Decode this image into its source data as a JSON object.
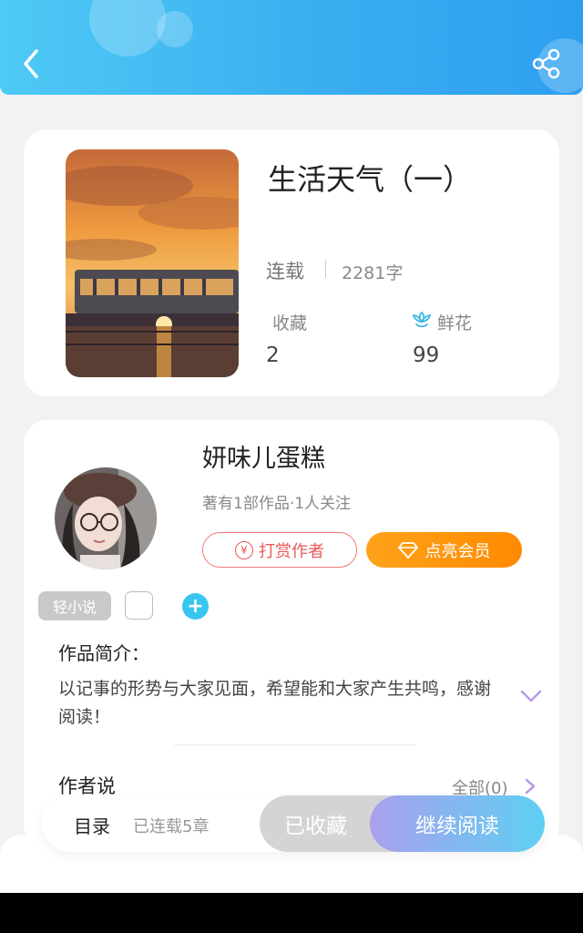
{
  "book": {
    "title": "生活天气（一）",
    "status": "连载",
    "word_count": "2281字",
    "favorites_label": "收藏",
    "favorites_value": "2",
    "flowers_label": "鲜花",
    "flowers_value": "99"
  },
  "author": {
    "name": "妍味儿蛋糕",
    "meta": "著有1部作品·1人关注",
    "tip_label": "打赏作者",
    "tip_symbol": "¥",
    "vip_label": "点亮会员"
  },
  "tags": {
    "genre": "轻小说",
    "add_symbol": "+"
  },
  "intro": {
    "label": "作品简介：",
    "text": "以记事的形势与大家见面，希望能和大家产生共鸣，感谢阅读！"
  },
  "author_says": {
    "label": "作者说",
    "all_link": "全部(0)"
  },
  "bottom_bar": {
    "toc_label": "目录",
    "toc_status": "已连载5章",
    "collected_label": "已收藏",
    "continue_label": "继续阅读"
  },
  "colors": {
    "header_blue": "#3aaef0",
    "tip_red": "#e85a5a",
    "vip_orange": "#ff9a10",
    "add_blue": "#38c6f0",
    "chevron_purple": "#b79ae8"
  }
}
